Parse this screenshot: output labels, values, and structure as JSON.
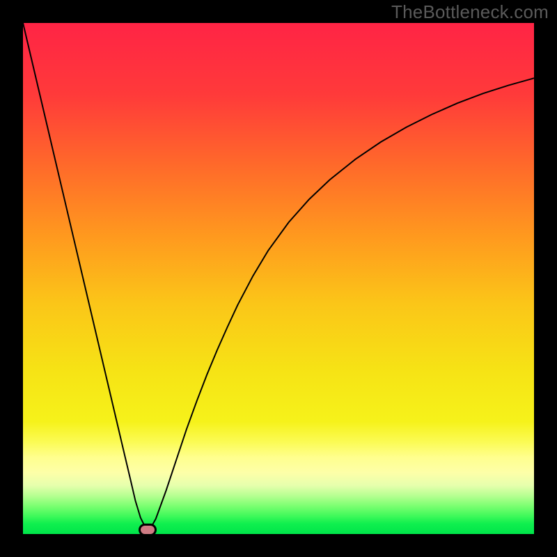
{
  "watermark": "TheBottleneck.com",
  "chart_data": {
    "type": "line",
    "title": "",
    "xlabel": "",
    "ylabel": "",
    "xlim": [
      0,
      100
    ],
    "ylim": [
      0,
      100
    ],
    "series": [
      {
        "name": "curve",
        "x": [
          0,
          2,
          4,
          6,
          8,
          10,
          12,
          14,
          16,
          18,
          20,
          21,
          22,
          23,
          24,
          25,
          26,
          28,
          30,
          32,
          34,
          36,
          38,
          40,
          42,
          45,
          48,
          52,
          56,
          60,
          65,
          70,
          75,
          80,
          85,
          90,
          95,
          100
        ],
        "y": [
          100,
          91.5,
          83,
          74.5,
          66,
          57.5,
          49,
          40.5,
          32,
          23.5,
          15,
          10.8,
          6.5,
          3.2,
          1.2,
          1.2,
          3.0,
          8.5,
          14.5,
          20.5,
          26.0,
          31.2,
          36.0,
          40.5,
          44.8,
          50.5,
          55.5,
          61.0,
          65.5,
          69.3,
          73.3,
          76.7,
          79.6,
          82.1,
          84.3,
          86.2,
          87.8,
          89.2
        ]
      }
    ],
    "marker": {
      "name": "bottleneck-zone",
      "x_center": 24.3,
      "y": 0,
      "width_pct": 2.8,
      "color": "#cf7b84"
    },
    "background_gradient_colors": [
      "#ff2445",
      "#ff512e",
      "#ff931e",
      "#fcc917",
      "#f5ee15",
      "#ffff7d",
      "#8aff73",
      "#00e54a"
    ]
  }
}
